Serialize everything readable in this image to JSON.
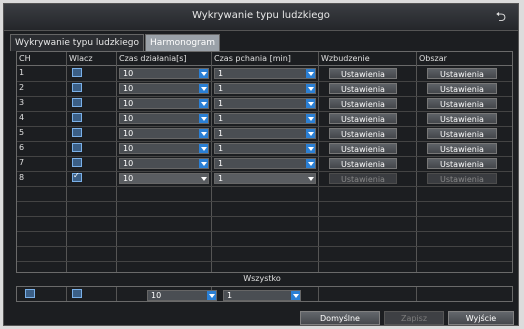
{
  "window": {
    "title": "Wykrywanie typu ludzkiego",
    "back_icon": "return-arrow-icon"
  },
  "tabs": [
    {
      "label": "Wykrywanie typu ludzkiego",
      "active": false
    },
    {
      "label": "Harmonogram",
      "active": true
    }
  ],
  "columns": [
    "CH",
    "Wlacz",
    "Czas działania[s]",
    "Czas pchania [min]",
    "Wzbudzenie",
    "Obszar"
  ],
  "rows": [
    {
      "ch": "1",
      "enabled": false,
      "duration": "10",
      "push": "1",
      "trigger": "Ustawienia",
      "area": "Ustawienia"
    },
    {
      "ch": "2",
      "enabled": false,
      "duration": "10",
      "push": "1",
      "trigger": "Ustawienia",
      "area": "Ustawienia"
    },
    {
      "ch": "3",
      "enabled": false,
      "duration": "10",
      "push": "1",
      "trigger": "Ustawienia",
      "area": "Ustawienia"
    },
    {
      "ch": "4",
      "enabled": false,
      "duration": "10",
      "push": "1",
      "trigger": "Ustawienia",
      "area": "Ustawienia"
    },
    {
      "ch": "5",
      "enabled": false,
      "duration": "10",
      "push": "1",
      "trigger": "Ustawienia",
      "area": "Ustawienia"
    },
    {
      "ch": "6",
      "enabled": false,
      "duration": "10",
      "push": "1",
      "trigger": "Ustawienia",
      "area": "Ustawienia"
    },
    {
      "ch": "7",
      "enabled": false,
      "duration": "10",
      "push": "1",
      "trigger": "Ustawienia",
      "area": "Ustawienia"
    },
    {
      "ch": "8",
      "enabled": true,
      "duration": "10",
      "push": "1",
      "trigger": "Ustawienia",
      "area": "Ustawienia"
    }
  ],
  "all": {
    "label": "Wszystko",
    "duration": "10",
    "push": "1"
  },
  "footer": {
    "default_label": "Domyślne",
    "save_label": "Zapisz",
    "exit_label": "Wyjście"
  },
  "colors": {
    "checkbox": "#3b5f86",
    "dropdown_arrow": "#2a7fd4",
    "active_tab": "#9aa1a8"
  }
}
